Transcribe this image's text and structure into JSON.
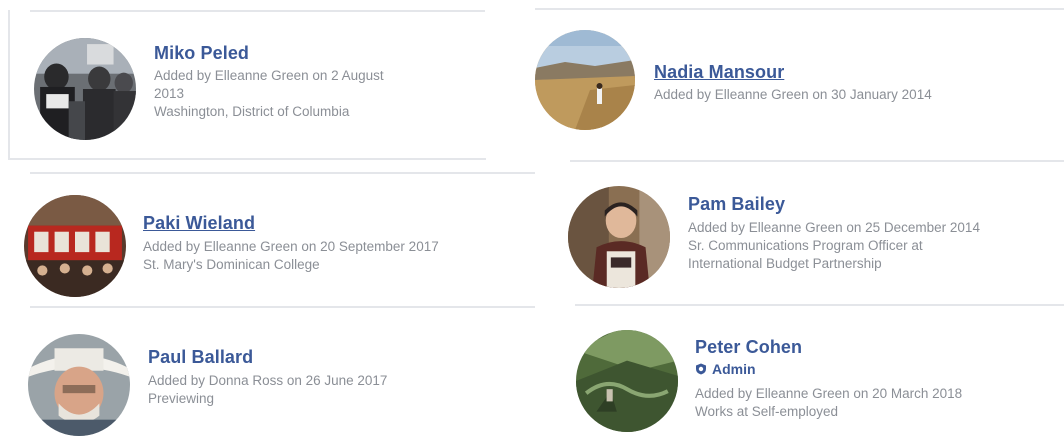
{
  "members": [
    {
      "name": "Miko Peled",
      "added": "Added by Elleanne Green on 2 August",
      "added_cont": "2013",
      "detail": "Washington, District of Columbia",
      "avatar": "crowd-photo"
    },
    {
      "name": "Nadia Mansour",
      "added": "Added by Elleanne Green on 30 January 2014",
      "avatar": "desert-landscape-photo"
    },
    {
      "name": "Paki Wieland",
      "added": "Added by Elleanne Green on 20 September 2017",
      "detail": "St. Mary's Dominican College",
      "avatar": "group-banner-photo"
    },
    {
      "name": "Pam Bailey",
      "added": "Added by Elleanne Green on 25 December 2014",
      "detail": "Sr. Communications Program Officer at",
      "detail2": "International Budget Partnership",
      "avatar": "portrait-photo"
    },
    {
      "name": "Paul Ballard",
      "added": "Added by Donna Ross on 26 June 2017",
      "detail": "Previewing",
      "avatar": "hat-portrait-photo"
    },
    {
      "name": "Peter Cohen",
      "badge": "Admin",
      "added": "Added by Elleanne Green on 20 March 2018",
      "detail": "Works at Self-employed",
      "avatar": "mountain-photo"
    }
  ],
  "colors": {
    "name": "#3b5998",
    "meta": "#8b8f96",
    "divider": "#e4e6ea"
  }
}
